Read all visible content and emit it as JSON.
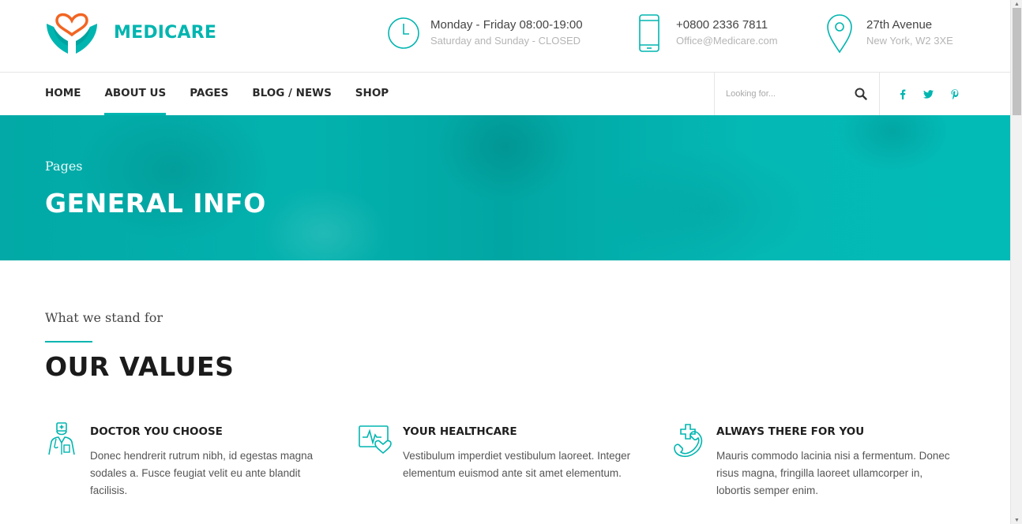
{
  "brand": {
    "name": "MEDICARE",
    "accent_color": "#00b5b0",
    "heart_color": "#f26522"
  },
  "header": {
    "hours": {
      "line1": "Monday - Friday 08:00-19:00",
      "line2": "Saturday and Sunday - CLOSED",
      "icon": "clock-icon"
    },
    "phone": {
      "line1": "+0800 2336 7811",
      "line2": "Office@Medicare.com",
      "icon": "mobile-phone-icon"
    },
    "address": {
      "line1": "27th Avenue",
      "line2": "New York, W2 3XE",
      "icon": "map-pin-icon"
    }
  },
  "nav": {
    "items": [
      {
        "label": "HOME",
        "active": false
      },
      {
        "label": "ABOUT US",
        "active": true
      },
      {
        "label": "PAGES",
        "active": false
      },
      {
        "label": "BLOG / NEWS",
        "active": false
      },
      {
        "label": "SHOP",
        "active": false
      }
    ],
    "search_placeholder": "Looking for...",
    "social": [
      "facebook-icon",
      "twitter-icon",
      "pinterest-icon"
    ]
  },
  "hero": {
    "subtitle": "Pages",
    "title": "GENERAL INFO"
  },
  "values": {
    "eyebrow": "What we stand for",
    "title": "OUR VALUES",
    "features": [
      {
        "title": "DOCTOR YOU CHOOSE",
        "text": "Donec hendrerit rutrum nibh, id egestas magna sodales a. Fusce feugiat velit eu ante blandit facilisis.",
        "icon": "doctor-icon"
      },
      {
        "title": "YOUR HEALTHCARE",
        "text": "Vestibulum imperdiet vestibulum laoreet. Integer elementum euismod ante sit amet elementum.",
        "icon": "heart-monitor-icon"
      },
      {
        "title": "ALWAYS THERE FOR YOU",
        "text": "Mauris commodo lacinia nisi a fermentum. Donec risus magna, fringilla laoreet ullamcorper in, lobortis semper enim.",
        "icon": "emergency-call-icon"
      }
    ]
  }
}
